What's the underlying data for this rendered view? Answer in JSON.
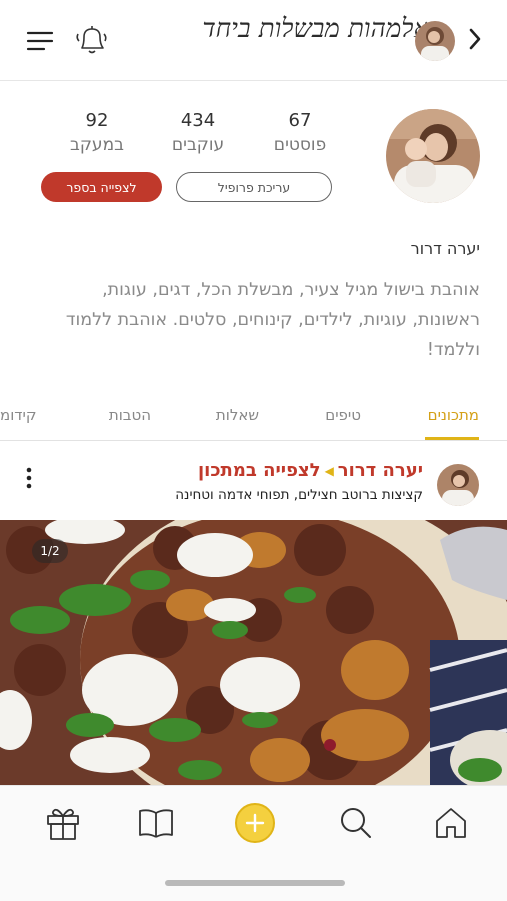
{
  "header": {
    "title": "אלמהות מבשלות ביחד",
    "back_icon": "chevron-right-icon",
    "menu_icon": "hamburger-menu-icon",
    "notify_icon": "bell-icon"
  },
  "profile": {
    "stats": [
      {
        "value": "67",
        "label": "פוסטים"
      },
      {
        "value": "434",
        "label": "עוקבים"
      },
      {
        "value": "92",
        "label": "במעקב"
      }
    ],
    "edit_button": "עריכת פרופיל",
    "book_button": "לצפייה בספר",
    "name": "יערה דרור",
    "bio": "אוהבת בישול מגיל צעיר, מבשלת הכל, דגים, עוגות, ראשונות, עוגיות, לילדים, קינוחים, סלטים. אוהבת ללמוד וללמד!"
  },
  "tabs": [
    {
      "label": "מתכונים",
      "active": true
    },
    {
      "label": "טיפים",
      "active": false
    },
    {
      "label": "שאלות",
      "active": false
    },
    {
      "label": "הטבות",
      "active": false
    },
    {
      "label": "קידומ",
      "active": false
    }
  ],
  "post": {
    "author": "יערה דרור",
    "link": "לצפייה במתכון",
    "subtitle": "קציצות ברוטב חצילים, תפוחי אדמה וטחינה",
    "counter": "1/2"
  },
  "bottom_nav": [
    "gift-icon",
    "book-icon",
    "add-icon",
    "search-icon",
    "home-icon"
  ],
  "colors": {
    "accent": "#e0b417",
    "brand_red": "#c0392b",
    "muted": "#8a8a8a"
  }
}
